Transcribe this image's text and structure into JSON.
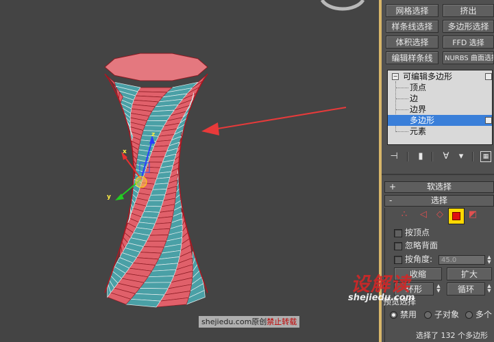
{
  "modifier_buttons": [
    {
      "id": "mesh-select",
      "label": "网格选择"
    },
    {
      "id": "extrude",
      "label": "挤出"
    },
    {
      "id": "spline-select",
      "label": "样条线选择"
    },
    {
      "id": "poly-select",
      "label": "多边形选择"
    },
    {
      "id": "volume-select",
      "label": "体积选择"
    },
    {
      "id": "ffd-select",
      "label": "FFD 选择"
    },
    {
      "id": "edit-spline",
      "label": "编辑样条线"
    },
    {
      "id": "nurbs-surface-select",
      "label": "NURBS 曲面选择"
    }
  ],
  "modifier_stack": {
    "root": "可编辑多边形",
    "items": [
      "顶点",
      "边",
      "边界",
      "多边形",
      "元素"
    ],
    "selected": "多边形"
  },
  "rollouts": {
    "soft_selection": {
      "sign": "+",
      "title": "软选择"
    },
    "selection": {
      "sign": "-",
      "title": "选择"
    }
  },
  "selection": {
    "by_vertex": "按顶点",
    "ignore_backfacing": "忽略背面",
    "by_angle": "按角度:",
    "angle_value": "45.0",
    "shrink": "收缩",
    "grow": "扩大",
    "ring": "环形",
    "loop": "循环",
    "preview_label": "预览选择",
    "preview_options": [
      "禁用",
      "子对象",
      "多个"
    ],
    "preview_selected": "禁用",
    "status": "选择了 132 个多边形"
  },
  "viewport": {
    "axes": {
      "x": "x",
      "y": "y",
      "z": "z"
    }
  },
  "watermark": {
    "logo": "设解读",
    "url": "shejiedu.com",
    "badge_site": "shejiedu.com原创",
    "badge_warning": "禁止转载"
  },
  "colors": {
    "viewport_bg": "#444444",
    "panel_bg": "#505050",
    "face_selected": "#e0606a",
    "face_unselected": "#4aa0a6",
    "arrow": "#e83a3a",
    "highlight": "#ffd800",
    "stack_selected": "#3a7fd9"
  },
  "icons": {
    "pin_stack": "pin-icon",
    "show_end_result": "show-end-result-icon",
    "make_unique": "make-unique-icon",
    "remove_modifier": "trash-icon",
    "configure_sets": "configure-sets-icon"
  }
}
